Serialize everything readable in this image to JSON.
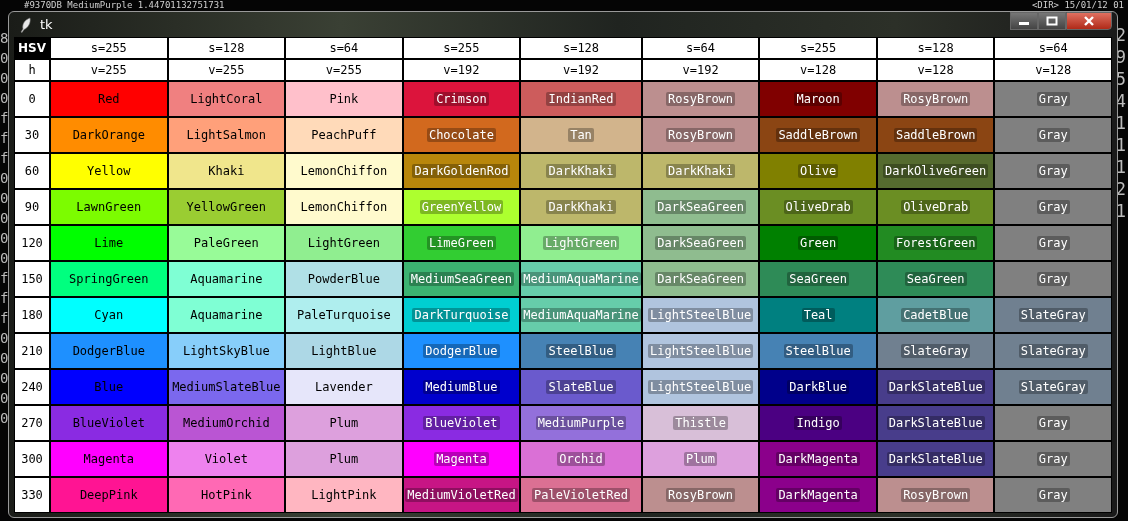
{
  "terminal": {
    "top_line": "#9370DB MediumPurple 1.44701132751731",
    "dir_line": "<DIR>  15/01/12 01",
    "left_column": [
      "8",
      "0",
      "0",
      "0",
      "f",
      "f",
      "f",
      "0",
      "0",
      "0",
      "0",
      "0",
      "f",
      "f",
      "f",
      "0",
      "0",
      "0",
      "0",
      "0"
    ],
    "right_column": [
      "2",
      "9",
      "5",
      "4",
      "1",
      "1",
      "1",
      "2",
      "1"
    ]
  },
  "window": {
    "title": "tk"
  },
  "table": {
    "corner_top": "HSV",
    "corner_bottom": "h",
    "columns": [
      {
        "s": "s=255",
        "v": "v=255",
        "light_text": false
      },
      {
        "s": "s=128",
        "v": "v=255",
        "light_text": false
      },
      {
        "s": "s=64",
        "v": "v=255",
        "light_text": false
      },
      {
        "s": "s=255",
        "v": "v=192",
        "light_text": true
      },
      {
        "s": "s=128",
        "v": "v=192",
        "light_text": true
      },
      {
        "s": "s=64",
        "v": "v=192",
        "light_text": true
      },
      {
        "s": "s=255",
        "v": "v=128",
        "light_text": true
      },
      {
        "s": "s=128",
        "v": "v=128",
        "light_text": true
      },
      {
        "s": "s=64",
        "v": "v=128",
        "light_text": true
      }
    ],
    "rows": [
      {
        "h": "0",
        "cells": [
          {
            "name": "Red",
            "color": "#ff0000"
          },
          {
            "name": "LightCoral",
            "color": "#f08080"
          },
          {
            "name": "Pink",
            "color": "#ffc0cb"
          },
          {
            "name": "Crimson",
            "color": "#dc143c"
          },
          {
            "name": "IndianRed",
            "color": "#cd5c5c"
          },
          {
            "name": "RosyBrown",
            "color": "#bc8f8f"
          },
          {
            "name": "Maroon",
            "color": "#800000"
          },
          {
            "name": "RosyBrown",
            "color": "#bc8f8f"
          },
          {
            "name": "Gray",
            "color": "#808080"
          }
        ]
      },
      {
        "h": "30",
        "cells": [
          {
            "name": "DarkOrange",
            "color": "#ff8c00"
          },
          {
            "name": "LightSalmon",
            "color": "#ffa07a"
          },
          {
            "name": "PeachPuff",
            "color": "#ffdab9"
          },
          {
            "name": "Chocolate",
            "color": "#d2691e"
          },
          {
            "name": "Tan",
            "color": "#d2b48c"
          },
          {
            "name": "RosyBrown",
            "color": "#bc8f8f"
          },
          {
            "name": "SaddleBrown",
            "color": "#8b4513"
          },
          {
            "name": "SaddleBrown",
            "color": "#8b4513"
          },
          {
            "name": "Gray",
            "color": "#808080"
          }
        ]
      },
      {
        "h": "60",
        "cells": [
          {
            "name": "Yellow",
            "color": "#ffff00"
          },
          {
            "name": "Khaki",
            "color": "#f0e68c"
          },
          {
            "name": "LemonChiffon",
            "color": "#fffacd"
          },
          {
            "name": "DarkGoldenRod",
            "color": "#b8860b"
          },
          {
            "name": "DarkKhaki",
            "color": "#bdb76b"
          },
          {
            "name": "DarkKhaki",
            "color": "#bdb76b"
          },
          {
            "name": "Olive",
            "color": "#808000"
          },
          {
            "name": "DarkOliveGreen",
            "color": "#556b2f"
          },
          {
            "name": "Gray",
            "color": "#808080"
          }
        ]
      },
      {
        "h": "90",
        "cells": [
          {
            "name": "LawnGreen",
            "color": "#7cfc00"
          },
          {
            "name": "YellowGreen",
            "color": "#9acd32"
          },
          {
            "name": "LemonChiffon",
            "color": "#fffacd"
          },
          {
            "name": "GreenYellow",
            "color": "#adff2f"
          },
          {
            "name": "DarkKhaki",
            "color": "#bdb76b"
          },
          {
            "name": "DarkSeaGreen",
            "color": "#8fbc8f"
          },
          {
            "name": "OliveDrab",
            "color": "#6b8e23"
          },
          {
            "name": "OliveDrab",
            "color": "#6b8e23"
          },
          {
            "name": "Gray",
            "color": "#808080"
          }
        ]
      },
      {
        "h": "120",
        "cells": [
          {
            "name": "Lime",
            "color": "#00ff00"
          },
          {
            "name": "PaleGreen",
            "color": "#98fb98"
          },
          {
            "name": "LightGreen",
            "color": "#90ee90"
          },
          {
            "name": "LimeGreen",
            "color": "#32cd32"
          },
          {
            "name": "LightGreen",
            "color": "#90ee90"
          },
          {
            "name": "DarkSeaGreen",
            "color": "#8fbc8f"
          },
          {
            "name": "Green",
            "color": "#008000"
          },
          {
            "name": "ForestGreen",
            "color": "#228b22"
          },
          {
            "name": "Gray",
            "color": "#808080"
          }
        ]
      },
      {
        "h": "150",
        "cells": [
          {
            "name": "SpringGreen",
            "color": "#00ff7f"
          },
          {
            "name": "Aquamarine",
            "color": "#7fffd4"
          },
          {
            "name": "PowderBlue",
            "color": "#b0e0e6"
          },
          {
            "name": "MediumSeaGreen",
            "color": "#3cb371"
          },
          {
            "name": "MediumAquaMarine",
            "color": "#66cdaa"
          },
          {
            "name": "DarkSeaGreen",
            "color": "#8fbc8f"
          },
          {
            "name": "SeaGreen",
            "color": "#2e8b57"
          },
          {
            "name": "SeaGreen",
            "color": "#2e8b57"
          },
          {
            "name": "Gray",
            "color": "#808080"
          }
        ]
      },
      {
        "h": "180",
        "cells": [
          {
            "name": "Cyan",
            "color": "#00ffff"
          },
          {
            "name": "Aquamarine",
            "color": "#7fffd4"
          },
          {
            "name": "PaleTurquoise",
            "color": "#afeeee"
          },
          {
            "name": "DarkTurquoise",
            "color": "#00ced1"
          },
          {
            "name": "MediumAquaMarine",
            "color": "#66cdaa"
          },
          {
            "name": "LightSteelBlue",
            "color": "#b0c4de"
          },
          {
            "name": "Teal",
            "color": "#008080"
          },
          {
            "name": "CadetBlue",
            "color": "#5f9ea0"
          },
          {
            "name": "SlateGray",
            "color": "#708090"
          }
        ]
      },
      {
        "h": "210",
        "cells": [
          {
            "name": "DodgerBlue",
            "color": "#1e90ff"
          },
          {
            "name": "LightSkyBlue",
            "color": "#87cefa"
          },
          {
            "name": "LightBlue",
            "color": "#add8e6"
          },
          {
            "name": "DodgerBlue",
            "color": "#1e90ff"
          },
          {
            "name": "SteelBlue",
            "color": "#4682b4"
          },
          {
            "name": "LightSteelBlue",
            "color": "#b0c4de"
          },
          {
            "name": "SteelBlue",
            "color": "#4682b4"
          },
          {
            "name": "SlateGray",
            "color": "#708090"
          },
          {
            "name": "SlateGray",
            "color": "#708090"
          }
        ]
      },
      {
        "h": "240",
        "cells": [
          {
            "name": "Blue",
            "color": "#0000ff"
          },
          {
            "name": "MediumSlateBlue",
            "color": "#7b68ee"
          },
          {
            "name": "Lavender",
            "color": "#e6e6fa"
          },
          {
            "name": "MediumBlue",
            "color": "#0000cd"
          },
          {
            "name": "SlateBlue",
            "color": "#6a5acd"
          },
          {
            "name": "LightSteelBlue",
            "color": "#b0c4de"
          },
          {
            "name": "DarkBlue",
            "color": "#00008b"
          },
          {
            "name": "DarkSlateBlue",
            "color": "#483d8b"
          },
          {
            "name": "SlateGray",
            "color": "#708090"
          }
        ]
      },
      {
        "h": "270",
        "cells": [
          {
            "name": "BlueViolet",
            "color": "#8a2be2"
          },
          {
            "name": "MediumOrchid",
            "color": "#ba55d3"
          },
          {
            "name": "Plum",
            "color": "#dda0dd"
          },
          {
            "name": "BlueViolet",
            "color": "#8a2be2"
          },
          {
            "name": "MediumPurple",
            "color": "#9370db"
          },
          {
            "name": "Thistle",
            "color": "#d8bfd8"
          },
          {
            "name": "Indigo",
            "color": "#4b0082"
          },
          {
            "name": "DarkSlateBlue",
            "color": "#483d8b"
          },
          {
            "name": "Gray",
            "color": "#808080"
          }
        ]
      },
      {
        "h": "300",
        "cells": [
          {
            "name": "Magenta",
            "color": "#ff00ff"
          },
          {
            "name": "Violet",
            "color": "#ee82ee"
          },
          {
            "name": "Plum",
            "color": "#dda0dd"
          },
          {
            "name": "Magenta",
            "color": "#ff00ff"
          },
          {
            "name": "Orchid",
            "color": "#da70d6"
          },
          {
            "name": "Plum",
            "color": "#dda0dd"
          },
          {
            "name": "DarkMagenta",
            "color": "#8b008b"
          },
          {
            "name": "DarkSlateBlue",
            "color": "#483d8b"
          },
          {
            "name": "Gray",
            "color": "#808080"
          }
        ]
      },
      {
        "h": "330",
        "cells": [
          {
            "name": "DeepPink",
            "color": "#ff1493"
          },
          {
            "name": "HotPink",
            "color": "#ff69b4"
          },
          {
            "name": "LightPink",
            "color": "#ffb6c1"
          },
          {
            "name": "MediumVioletRed",
            "color": "#c71585"
          },
          {
            "name": "PaleVioletRed",
            "color": "#db7093"
          },
          {
            "name": "RosyBrown",
            "color": "#bc8f8f"
          },
          {
            "name": "DarkMagenta",
            "color": "#8b008b"
          },
          {
            "name": "RosyBrown",
            "color": "#bc8f8f"
          },
          {
            "name": "Gray",
            "color": "#808080"
          }
        ]
      }
    ]
  }
}
